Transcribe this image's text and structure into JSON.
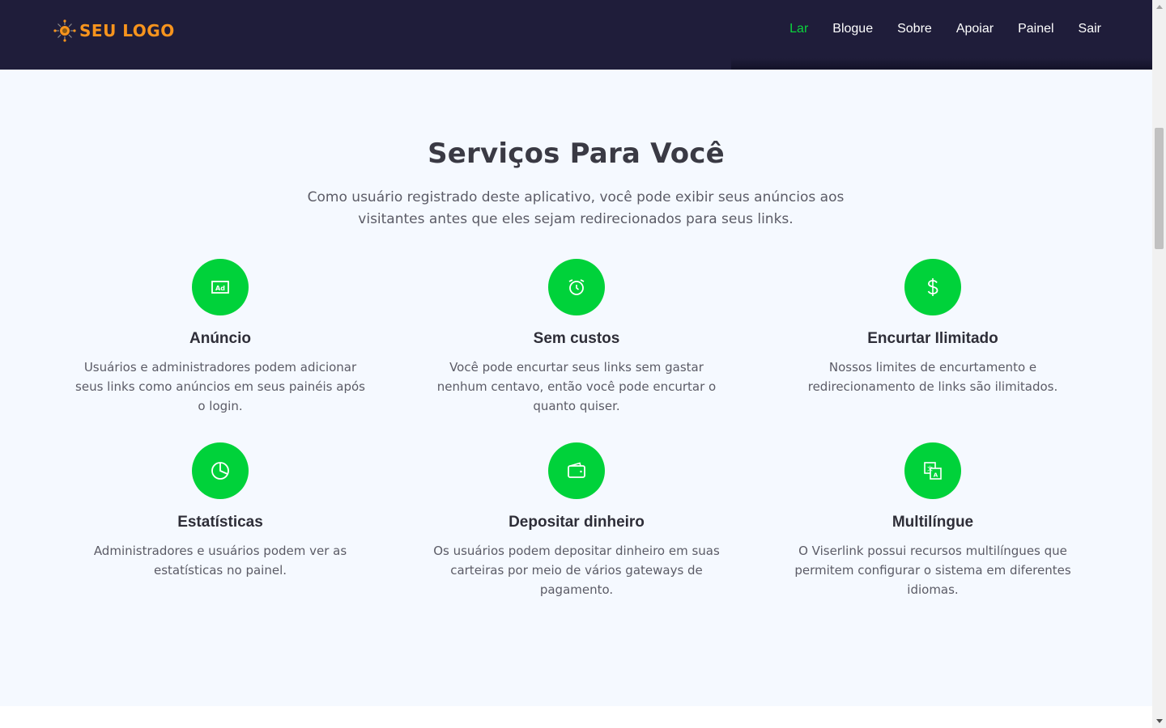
{
  "header": {
    "logo_text": "SEU LOGO",
    "nav": [
      {
        "label": "Lar",
        "active": true
      },
      {
        "label": "Blogue",
        "active": false
      },
      {
        "label": "Sobre",
        "active": false
      },
      {
        "label": "Apoiar",
        "active": false
      },
      {
        "label": "Painel",
        "active": false
      },
      {
        "label": "Sair",
        "active": false
      }
    ]
  },
  "services": {
    "title": "Serviços Para Você",
    "subtitle": "Como usuário registrado deste aplicativo, você pode exibir seus anúncios aos visitantes antes que eles sejam redirecionados para seus links.",
    "items": [
      {
        "icon": "ad-icon",
        "title": "Anúncio",
        "text": "Usuários e administradores podem adicionar seus links como anúncios em seus painéis após o login."
      },
      {
        "icon": "alarm-clock-icon",
        "title": "Sem custos",
        "text": "Você pode encurtar seus links sem gastar nenhum centavo, então você pode encurtar o quanto quiser."
      },
      {
        "icon": "dollar-icon",
        "title": "Encurtar Ilimitado",
        "text": "Nossos limites de encurtamento e redirecionamento de links são ilimitados."
      },
      {
        "icon": "pie-chart-icon",
        "title": "Estatísticas",
        "text": "Administradores e usuários podem ver as estatísticas no painel."
      },
      {
        "icon": "wallet-icon",
        "title": "Depositar dinheiro",
        "text": "Os usuários podem depositar dinheiro em suas carteiras por meio de vários gateways de pagamento."
      },
      {
        "icon": "translate-icon",
        "title": "Multilíngue",
        "text": "O Viserlink possui recursos multilíngues que permitem configurar o sistema em diferentes idiomas."
      }
    ]
  },
  "colors": {
    "header_bg": "#1f1d3a",
    "accent_green": "#00d23a",
    "nav_active": "#0bd43c",
    "logo_orange": "#f7941d",
    "section_bg": "#f5f9ff"
  }
}
